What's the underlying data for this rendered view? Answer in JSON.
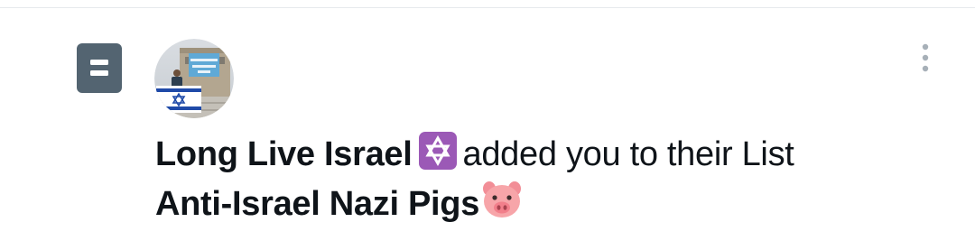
{
  "notification": {
    "type_icon": "list-icon",
    "account_name": "Long Live Israel",
    "name_emoji": "star-of-david-emoji",
    "action_text": "added you to their List",
    "list_name": "Anti-Israel Nazi Pigs",
    "list_emoji": "pig-face-emoji",
    "more_icon": "more-vertical-icon"
  },
  "colors": {
    "icon_gray": "#536471",
    "text": "#0f1419",
    "emoji_purple": "#9b59b6",
    "pig_pink": "#f7a5a9"
  }
}
